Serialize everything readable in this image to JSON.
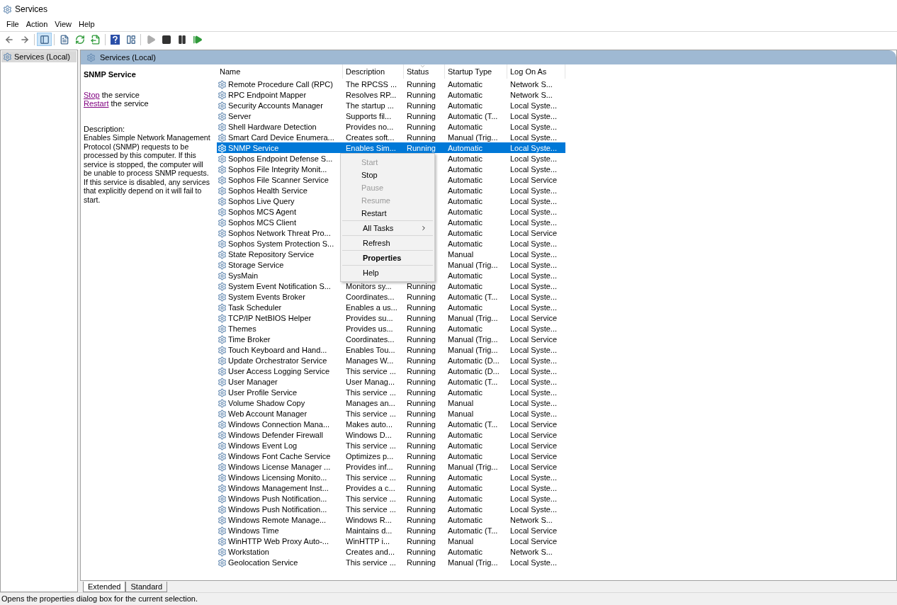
{
  "window": {
    "title": "Services"
  },
  "menu": [
    "File",
    "Action",
    "View",
    "Help"
  ],
  "toolbar": [
    {
      "kind": "back",
      "pressed": false,
      "disabled": false
    },
    {
      "kind": "forward",
      "pressed": false,
      "disabled": false
    },
    {
      "kind": "tree",
      "pressed": true,
      "disabled": false
    },
    {
      "kind": "properties",
      "pressed": false,
      "disabled": false
    },
    {
      "kind": "refresh",
      "pressed": false,
      "disabled": false
    },
    {
      "kind": "export",
      "pressed": false,
      "disabled": false
    },
    {
      "kind": "help",
      "pressed": false,
      "disabled": false
    },
    {
      "kind": "view",
      "pressed": false,
      "disabled": false
    },
    {
      "kind": "start",
      "pressed": false,
      "disabled": true
    },
    {
      "kind": "stop",
      "pressed": false,
      "disabled": false
    },
    {
      "kind": "pause",
      "pressed": false,
      "disabled": false
    },
    {
      "kind": "resume",
      "pressed": false,
      "disabled": false
    }
  ],
  "tree": {
    "items": [
      {
        "label": "Services (Local)",
        "selected": true
      }
    ]
  },
  "panel": {
    "title": "Services (Local)"
  },
  "details": {
    "service_name": "SNMP Service",
    "actions": [
      {
        "link": "Stop",
        "text": "the service"
      },
      {
        "link": "Restart",
        "text": "the service"
      }
    ],
    "description_label": "Description:",
    "description": "Enables Simple Network Management Protocol (SNMP) requests to be processed by this computer. If this service is stopped, the computer will be unable to process SNMP requests. If this service is disabled, any services that explicitly depend on it will fail to start."
  },
  "services": {
    "columns": [
      {
        "label": "Name",
        "sorted": false
      },
      {
        "label": "Description",
        "sorted": false
      },
      {
        "label": "Status",
        "sorted": true
      },
      {
        "label": "Startup Type",
        "sorted": false
      },
      {
        "label": "Log On As",
        "sorted": false
      }
    ],
    "rows": [
      {
        "name": "Remote Procedure Call (RPC)",
        "description": "The RPCSS ...",
        "status": "Running",
        "startup": "Automatic",
        "logon": "Network S...",
        "selected": false
      },
      {
        "name": "RPC Endpoint Mapper",
        "description": "Resolves RP...",
        "status": "Running",
        "startup": "Automatic",
        "logon": "Network S...",
        "selected": false
      },
      {
        "name": "Security Accounts Manager",
        "description": "The startup ...",
        "status": "Running",
        "startup": "Automatic",
        "logon": "Local Syste...",
        "selected": false
      },
      {
        "name": "Server",
        "description": "Supports fil...",
        "status": "Running",
        "startup": "Automatic (T...",
        "logon": "Local Syste...",
        "selected": false
      },
      {
        "name": "Shell Hardware Detection",
        "description": "Provides no...",
        "status": "Running",
        "startup": "Automatic",
        "logon": "Local Syste...",
        "selected": false
      },
      {
        "name": "Smart Card Device Enumera...",
        "description": "Creates soft...",
        "status": "Running",
        "startup": "Manual (Trig...",
        "logon": "Local Syste...",
        "selected": false
      },
      {
        "name": "SNMP Service",
        "description": "Enables Sim...",
        "status": "Running",
        "startup": "Automatic",
        "logon": "Local Syste...",
        "selected": true
      },
      {
        "name": "Sophos Endpoint Defense S...",
        "startup": "Automatic",
        "logon": "Local Syste...",
        "selected": false
      },
      {
        "name": "Sophos File Integrity Monit...",
        "startup": "Automatic",
        "logon": "Local Syste...",
        "selected": false
      },
      {
        "name": "Sophos File Scanner Service",
        "startup": "Automatic",
        "logon": "Local Service",
        "selected": false
      },
      {
        "name": "Sophos Health Service",
        "startup": "Automatic",
        "logon": "Local Syste...",
        "selected": false
      },
      {
        "name": "Sophos Live Query",
        "startup": "Automatic",
        "logon": "Local Syste...",
        "selected": false
      },
      {
        "name": "Sophos MCS Agent",
        "startup": "Automatic",
        "logon": "Local Syste...",
        "selected": false
      },
      {
        "name": "Sophos MCS Client",
        "startup": "Automatic",
        "logon": "Local Syste...",
        "selected": false
      },
      {
        "name": "Sophos Network Threat Pro...",
        "startup": "Automatic",
        "logon": "Local Service",
        "selected": false
      },
      {
        "name": "Sophos System Protection S...",
        "startup": "Automatic",
        "logon": "Local Syste...",
        "selected": false
      },
      {
        "name": "State Repository Service",
        "startup": "Manual",
        "logon": "Local Syste...",
        "selected": false
      },
      {
        "name": "Storage Service",
        "startup": "Manual (Trig...",
        "logon": "Local Syste...",
        "selected": false
      },
      {
        "name": "SysMain",
        "startup": "Automatic",
        "logon": "Local Syste...",
        "selected": false
      },
      {
        "name": "System Event Notification S...",
        "description": "Monitors sy...",
        "status": "Running",
        "startup": "Automatic",
        "logon": "Local Syste...",
        "selected": false
      },
      {
        "name": "System Events Broker",
        "description": "Coordinates...",
        "status": "Running",
        "startup": "Automatic (T...",
        "logon": "Local Syste...",
        "selected": false
      },
      {
        "name": "Task Scheduler",
        "description": "Enables a us...",
        "status": "Running",
        "startup": "Automatic",
        "logon": "Local Syste...",
        "selected": false
      },
      {
        "name": "TCP/IP NetBIOS Helper",
        "description": "Provides su...",
        "status": "Running",
        "startup": "Manual (Trig...",
        "logon": "Local Service",
        "selected": false
      },
      {
        "name": "Themes",
        "description": "Provides us...",
        "status": "Running",
        "startup": "Automatic",
        "logon": "Local Syste...",
        "selected": false
      },
      {
        "name": "Time Broker",
        "description": "Coordinates...",
        "status": "Running",
        "startup": "Manual (Trig...",
        "logon": "Local Service",
        "selected": false
      },
      {
        "name": "Touch Keyboard and Hand...",
        "description": "Enables Tou...",
        "status": "Running",
        "startup": "Manual (Trig...",
        "logon": "Local Syste...",
        "selected": false
      },
      {
        "name": "Update Orchestrator Service",
        "description": "Manages W...",
        "status": "Running",
        "startup": "Automatic (D...",
        "logon": "Local Syste...",
        "selected": false
      },
      {
        "name": "User Access Logging Service",
        "description": "This service ...",
        "status": "Running",
        "startup": "Automatic (D...",
        "logon": "Local Syste...",
        "selected": false
      },
      {
        "name": "User Manager",
        "description": "User Manag...",
        "status": "Running",
        "startup": "Automatic (T...",
        "logon": "Local Syste...",
        "selected": false
      },
      {
        "name": "User Profile Service",
        "description": "This service ...",
        "status": "Running",
        "startup": "Automatic",
        "logon": "Local Syste...",
        "selected": false
      },
      {
        "name": "Volume Shadow Copy",
        "description": "Manages an...",
        "status": "Running",
        "startup": "Manual",
        "logon": "Local Syste...",
        "selected": false
      },
      {
        "name": "Web Account Manager",
        "description": "This service ...",
        "status": "Running",
        "startup": "Manual",
        "logon": "Local Syste...",
        "selected": false
      },
      {
        "name": "Windows Connection Mana...",
        "description": "Makes auto...",
        "status": "Running",
        "startup": "Automatic (T...",
        "logon": "Local Service",
        "selected": false
      },
      {
        "name": "Windows Defender Firewall",
        "description": "Windows D...",
        "status": "Running",
        "startup": "Automatic",
        "logon": "Local Service",
        "selected": false
      },
      {
        "name": "Windows Event Log",
        "description": "This service ...",
        "status": "Running",
        "startup": "Automatic",
        "logon": "Local Service",
        "selected": false
      },
      {
        "name": "Windows Font Cache Service",
        "description": "Optimizes p...",
        "status": "Running",
        "startup": "Automatic",
        "logon": "Local Service",
        "selected": false
      },
      {
        "name": "Windows License Manager ...",
        "description": "Provides inf...",
        "status": "Running",
        "startup": "Manual (Trig...",
        "logon": "Local Service",
        "selected": false
      },
      {
        "name": "Windows Licensing Monito...",
        "description": "This service ...",
        "status": "Running",
        "startup": "Automatic",
        "logon": "Local Syste...",
        "selected": false
      },
      {
        "name": "Windows Management Inst...",
        "description": "Provides a c...",
        "status": "Running",
        "startup": "Automatic",
        "logon": "Local Syste...",
        "selected": false
      },
      {
        "name": "Windows Push Notification...",
        "description": "This service ...",
        "status": "Running",
        "startup": "Automatic",
        "logon": "Local Syste...",
        "selected": false
      },
      {
        "name": "Windows Push Notification...",
        "description": "This service ...",
        "status": "Running",
        "startup": "Automatic",
        "logon": "Local Syste...",
        "selected": false
      },
      {
        "name": "Windows Remote Manage...",
        "description": "Windows R...",
        "status": "Running",
        "startup": "Automatic",
        "logon": "Network S...",
        "selected": false
      },
      {
        "name": "Windows Time",
        "description": "Maintains d...",
        "status": "Running",
        "startup": "Automatic (T...",
        "logon": "Local Service",
        "selected": false
      },
      {
        "name": "WinHTTP Web Proxy Auto-...",
        "description": "WinHTTP i...",
        "status": "Running",
        "startup": "Manual",
        "logon": "Local Service",
        "selected": false
      },
      {
        "name": "Workstation",
        "description": "Creates and...",
        "status": "Running",
        "startup": "Automatic",
        "logon": "Network S...",
        "selected": false
      },
      {
        "name": "Geolocation Service",
        "description": "This service ...",
        "status": "Running",
        "startup": "Manual (Trig...",
        "logon": "Local Syste...",
        "selected": false
      }
    ]
  },
  "context_menu": {
    "groups": [
      [
        {
          "label": "Start",
          "disabled": true,
          "default": false,
          "submenu": false
        },
        {
          "label": "Stop",
          "disabled": false,
          "default": false,
          "submenu": false
        },
        {
          "label": "Pause",
          "disabled": true,
          "default": false,
          "submenu": false
        },
        {
          "label": "Resume",
          "disabled": true,
          "default": false,
          "submenu": false
        },
        {
          "label": "Restart",
          "disabled": false,
          "default": false,
          "submenu": false
        }
      ],
      [
        {
          "label": "All Tasks",
          "disabled": false,
          "default": false,
          "submenu": true
        }
      ],
      [
        {
          "label": "Refresh",
          "disabled": false,
          "default": false,
          "submenu": false
        }
      ],
      [
        {
          "label": "Properties",
          "disabled": false,
          "default": true,
          "submenu": false
        }
      ],
      [
        {
          "label": "Help",
          "disabled": false,
          "default": false,
          "submenu": false
        }
      ]
    ]
  },
  "view_tabs": [
    {
      "label": "Extended",
      "selected": true
    },
    {
      "label": "Standard",
      "selected": false
    }
  ],
  "status_bar": "Opens the properties dialog box for the current selection."
}
